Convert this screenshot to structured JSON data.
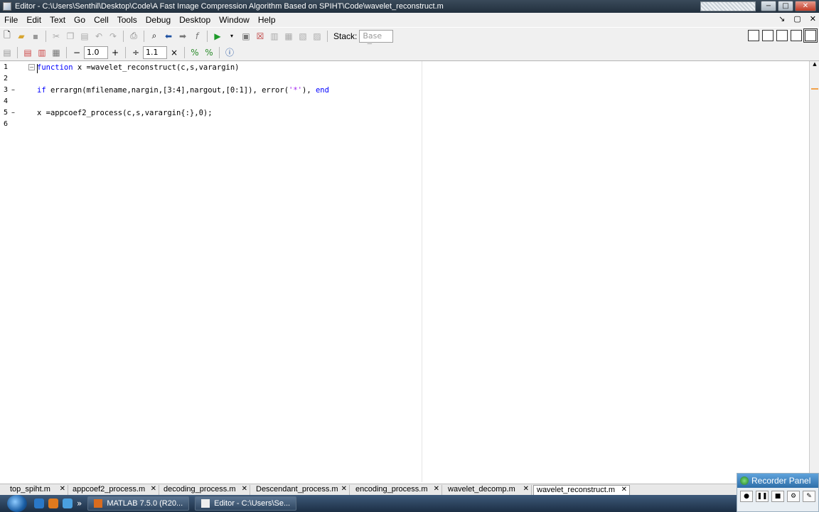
{
  "window": {
    "title": "Editor - C:\\Users\\Senthil\\Desktop\\Code\\A Fast Image Compression Algorithm Based on SPIHT\\Code\\wavelet_reconstruct.m",
    "minimize": "−",
    "maximize": "□",
    "close": "✕"
  },
  "menu": [
    "File",
    "Edit",
    "Text",
    "Go",
    "Cell",
    "Tools",
    "Debug",
    "Desktop",
    "Window",
    "Help"
  ],
  "toolbar": {
    "stack_label": "Stack:",
    "stack_value": "Base",
    "cell_minus": "−",
    "cell_value_1": "1.0",
    "cell_plus": "+",
    "cell_divide": "÷",
    "cell_value_2": "1.1",
    "cell_times": "×"
  },
  "editor": {
    "line_numbers": [
      "1",
      "2",
      "3",
      "4",
      "5",
      "6"
    ],
    "line1_kw": "function",
    "line1_rest": " x =wavelet_reconstruct(c,s,varargin)",
    "line3_if": "if",
    "line3_mid": " errargn(mfilename,nargin,[3:4],nargout,[0:1]), error(",
    "line3_str": "'*'",
    "line3_close": "), ",
    "line3_end": "end",
    "line5": "x =appcoef2_process(c,s,varargin{:},0);"
  },
  "tabs": [
    {
      "label": "top_spiht.m"
    },
    {
      "label": "appcoef2_process.m"
    },
    {
      "label": "decoding_process.m"
    },
    {
      "label": "Descendant_process.m"
    },
    {
      "label": "encoding_process.m"
    },
    {
      "label": "wavelet_decomp.m"
    },
    {
      "label": "wavelet_reconstruct.m"
    }
  ],
  "recorder": {
    "title": "Recorder Panel"
  },
  "taskbar": {
    "item1": "MATLAB 7.5.0 (R20...",
    "item2": "Editor - C:\\Users\\Se..."
  }
}
